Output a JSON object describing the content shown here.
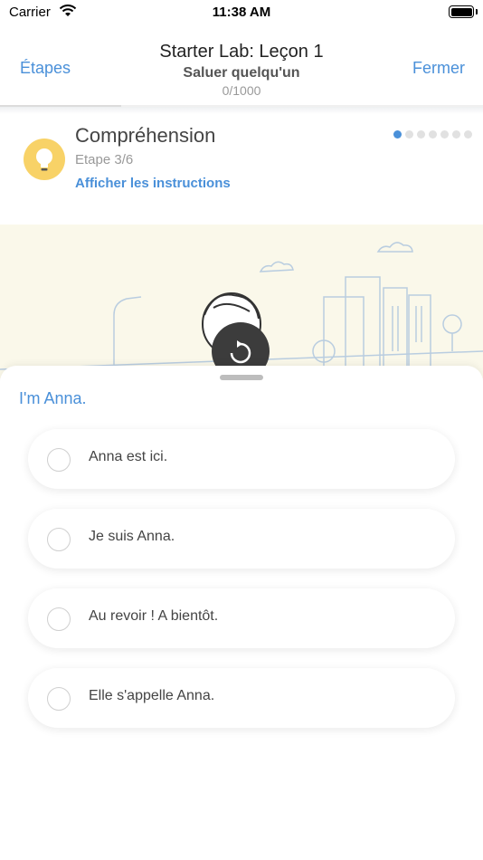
{
  "status_bar": {
    "carrier": "Carrier",
    "time": "11:38 AM"
  },
  "nav": {
    "back_label": "Étapes",
    "close_label": "Fermer",
    "title": "Starter Lab: Leçon 1",
    "subtitle": "Saluer quelqu'un",
    "progress_text": "0/1000"
  },
  "step": {
    "title": "Compréhension",
    "subtitle": "Etape 3/6",
    "instructions_link": "Afficher les instructions",
    "icon": "lightbulb-icon",
    "total_steps": 7,
    "current_step_dot": 1
  },
  "question": {
    "prompt": "I'm Anna.",
    "options": [
      "Anna est ici.",
      "Je suis Anna.",
      "Au revoir ! A bientôt.",
      "Elle s'appelle Anna."
    ]
  },
  "colors": {
    "accent": "#4a90d9",
    "icon_bg": "#f8d267",
    "illustration_bg": "#faf8ea"
  }
}
